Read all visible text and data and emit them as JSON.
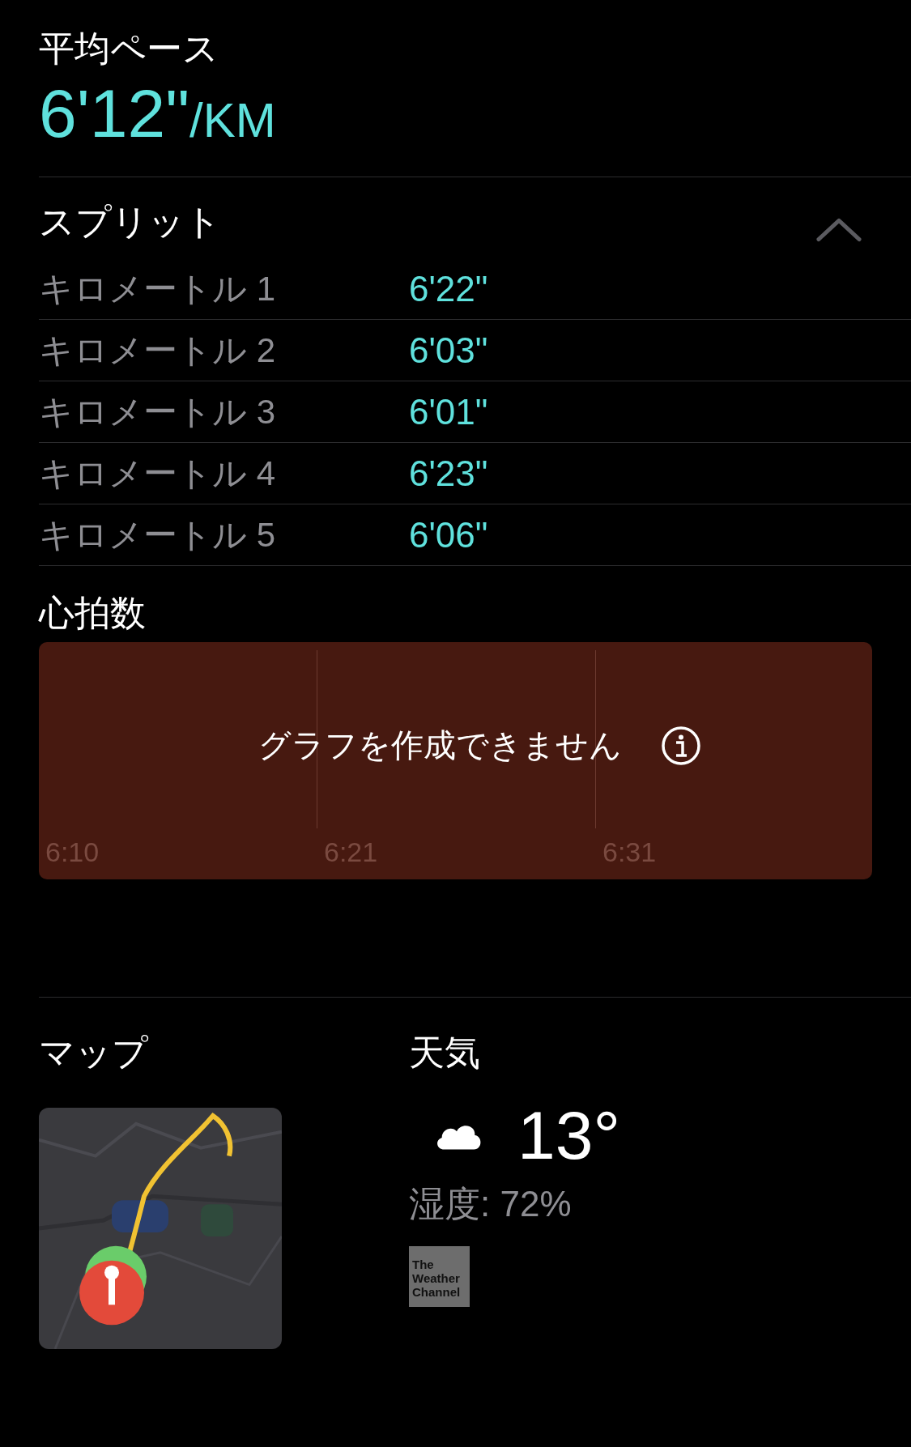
{
  "pace": {
    "label": "平均ペース",
    "value": "6'12\"",
    "unit": "/KM"
  },
  "splits": {
    "title": "スプリット",
    "expanded": true,
    "rows": [
      {
        "label": "キロメートル 1",
        "value": "6'22\""
      },
      {
        "label": "キロメートル 2",
        "value": "6'03\""
      },
      {
        "label": "キロメートル 3",
        "value": "6'01\""
      },
      {
        "label": "キロメートル 4",
        "value": "6'23\""
      },
      {
        "label": "キロメートル 5",
        "value": "6'06\""
      }
    ]
  },
  "heart_rate": {
    "title": "心拍数",
    "message": "グラフを作成できません",
    "x_labels": [
      "6:10",
      "6:21",
      "6:31"
    ]
  },
  "map": {
    "title": "マップ",
    "kind": "picture"
  },
  "weather": {
    "title": "天気",
    "temperature": "13°",
    "humidity": "湿度: 72%",
    "logo_text": [
      "The",
      "Weather",
      "Channel"
    ]
  }
}
